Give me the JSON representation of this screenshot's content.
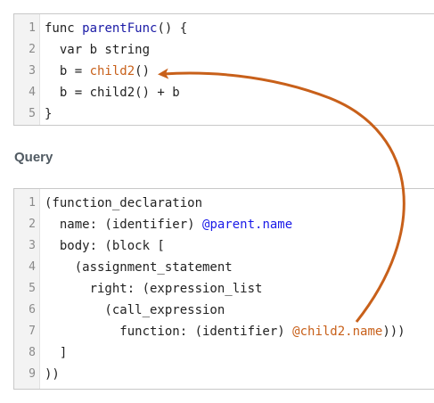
{
  "top_code": {
    "lines": [
      {
        "num": "1",
        "parts": [
          {
            "t": "func ",
            "c": ""
          },
          {
            "t": "parentFunc",
            "c": "fn-name"
          },
          {
            "t": "() {",
            "c": ""
          }
        ]
      },
      {
        "num": "2",
        "parts": [
          {
            "t": "  var b string",
            "c": ""
          }
        ]
      },
      {
        "num": "3",
        "parts": [
          {
            "t": "  b = ",
            "c": ""
          },
          {
            "t": "child2",
            "c": "call-orange"
          },
          {
            "t": "()",
            "c": ""
          }
        ]
      },
      {
        "num": "4",
        "parts": [
          {
            "t": "  b = child2() + b",
            "c": ""
          }
        ]
      },
      {
        "num": "5",
        "parts": [
          {
            "t": "}",
            "c": ""
          }
        ]
      }
    ]
  },
  "query": {
    "label": "Query",
    "lines": [
      {
        "num": "1",
        "parts": [
          {
            "t": "(function_declaration",
            "c": ""
          }
        ]
      },
      {
        "num": "2",
        "parts": [
          {
            "t": "  name: (identifier) ",
            "c": ""
          },
          {
            "t": "@parent.name",
            "c": "capture-parent"
          }
        ]
      },
      {
        "num": "3",
        "parts": [
          {
            "t": "  body: (block [",
            "c": ""
          }
        ]
      },
      {
        "num": "4",
        "parts": [
          {
            "t": "    (assignment_statement",
            "c": ""
          }
        ]
      },
      {
        "num": "5",
        "parts": [
          {
            "t": "      right: (expression_list",
            "c": ""
          }
        ]
      },
      {
        "num": "6",
        "parts": [
          {
            "t": "        (call_expression",
            "c": ""
          }
        ]
      },
      {
        "num": "7",
        "parts": [
          {
            "t": "          function: (identifier) ",
            "c": ""
          },
          {
            "t": "@child2.name",
            "c": "capture-child"
          },
          {
            "t": ")))",
            "c": ""
          }
        ]
      },
      {
        "num": "8",
        "parts": [
          {
            "t": "  ]",
            "c": ""
          }
        ]
      },
      {
        "num": "9",
        "parts": [
          {
            "t": "))",
            "c": ""
          }
        ]
      }
    ]
  },
  "colors": {
    "arrow": "#c8601a",
    "capture_parent": "#1a1ae8",
    "capture_child": "#c8601a",
    "function_name": "#1a1aa6"
  }
}
